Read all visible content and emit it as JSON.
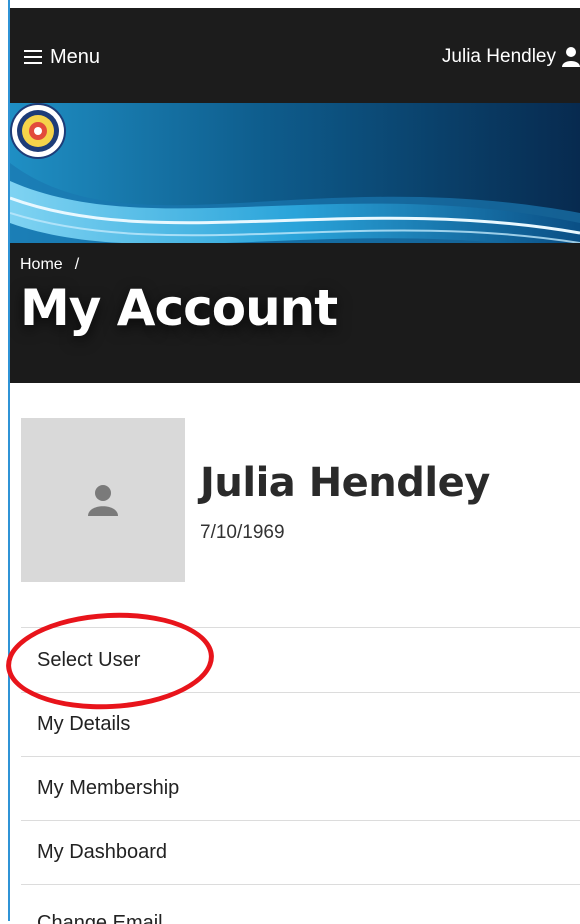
{
  "header": {
    "menu_label": "Menu",
    "user_name": "Julia Hendley"
  },
  "breadcrumb": {
    "home": "Home",
    "separator": "/"
  },
  "page_title": "My Account",
  "profile": {
    "name": "Julia Hendley",
    "dob": "7/10/1969"
  },
  "account_menu": {
    "items": [
      {
        "label": "Select User"
      },
      {
        "label": "My Details"
      },
      {
        "label": "My Membership"
      },
      {
        "label": "My Dashboard"
      },
      {
        "label": "Change Email"
      }
    ]
  },
  "colors": {
    "topbar": "#1c1c1c",
    "annotation": "#e8141b",
    "avatar_bg": "#d9d9d9"
  }
}
